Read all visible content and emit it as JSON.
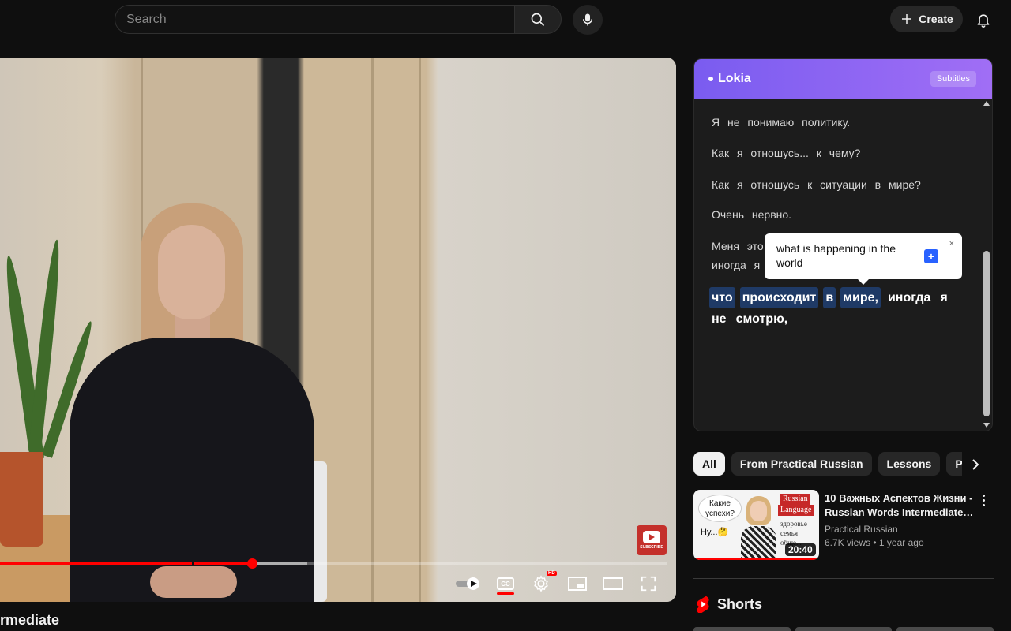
{
  "search": {
    "placeholder": "Search"
  },
  "header": {
    "create_label": "Create"
  },
  "video": {
    "title_fragment": "rmediate",
    "subscribe_text": "SUBSCRIBE",
    "cc_label": "CC",
    "hd_label": "HD",
    "progress_fraction": 0.377,
    "buffered_fraction": 0.46
  },
  "lokia": {
    "brand": "Lokia",
    "subtitles_label": "Subtitles",
    "lines": [
      "Я не понимаю политику.",
      "Как я отношусь... к чему?",
      "Как я отношусь к ситуации в мире?",
      "Очень нервно.",
      "Меня это",
      "иногда я"
    ],
    "active_words": [
      {
        "text": "что",
        "hl": true
      },
      {
        "text": "происходит",
        "hl": true
      },
      {
        "text": "в",
        "hl": true
      },
      {
        "text": "мире,",
        "hl": true
      },
      {
        "text": "иногда",
        "hl": false
      },
      {
        "text": "я",
        "hl": false
      },
      {
        "text": "не",
        "hl": false
      },
      {
        "text": "смотрю,",
        "hl": false
      }
    ],
    "tooltip": {
      "translation": "what is happening in the world",
      "close": "×",
      "add": "+"
    }
  },
  "chips": [
    "All",
    "From Practical Russian",
    "Lessons",
    "Pres"
  ],
  "recommended": {
    "title": "10 Важных Аспектов Жизни - Russian Words Intermediate…",
    "channel": "Practical Russian",
    "views": "6.7K views",
    "age": "1 year ago",
    "duration": "20:40",
    "thumb_bubble": "Какие успехи?",
    "thumb_nu": "Ну...🤔",
    "thumb_tag1": "Russian",
    "thumb_tag2": "Language",
    "thumb_words": [
      "здоровье",
      "семья",
      "обще..."
    ]
  },
  "shorts": {
    "title": "Shorts"
  },
  "colors": {
    "accent": "#ff0000",
    "lokia_purple": "#7a5cf0",
    "highlight": "#1f3a66"
  }
}
